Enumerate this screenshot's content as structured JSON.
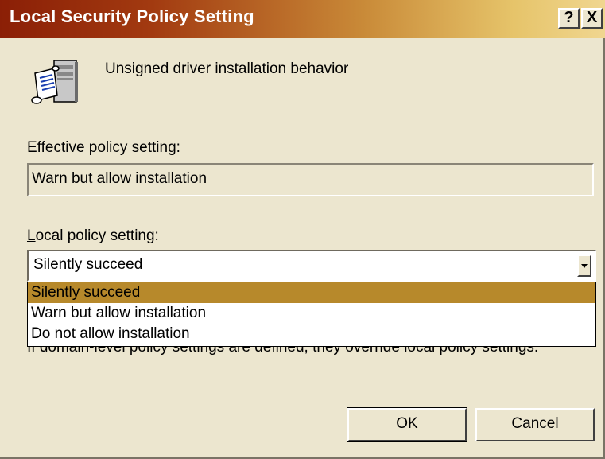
{
  "window": {
    "title": "Local Security Policy Setting",
    "help_glyph": "?",
    "close_glyph": "X"
  },
  "policy": {
    "name": "Unsigned driver installation behavior",
    "icon": "policy-document-computer-icon"
  },
  "effective": {
    "label": "Effective policy setting:",
    "value": "Warn but allow installation"
  },
  "local": {
    "label_underlined": "L",
    "label_rest": "ocal policy setting:",
    "selected": "Silently succeed",
    "options": [
      "Silently succeed",
      "Warn but allow installation",
      "Do not allow installation"
    ]
  },
  "note": "If domain-level policy settings are defined, they override local policy settings.",
  "buttons": {
    "ok": "OK",
    "cancel": "Cancel"
  },
  "colors": {
    "title_start": "#8b1f06",
    "title_end": "#f0d690",
    "highlight": "#b7892b",
    "dialog_bg": "#ece6cf"
  }
}
